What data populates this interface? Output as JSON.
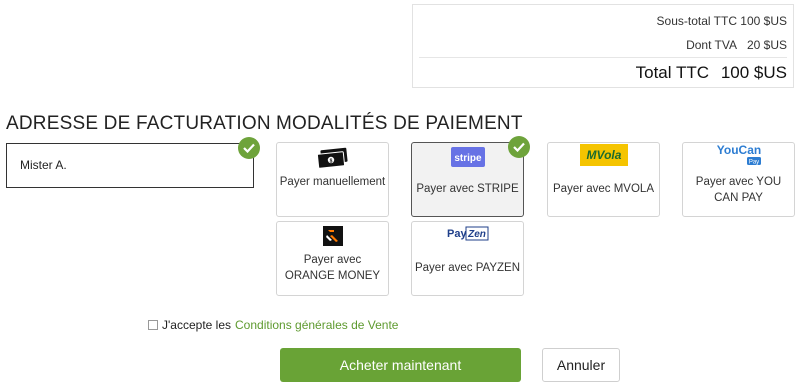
{
  "totals": {
    "subtotal_label": "Sous-total TTC",
    "subtotal_value": "100 $US",
    "tax_label": "Dont TVA",
    "tax_value": "20 $US",
    "total_label": "Total TTC",
    "total_value": "100 $US"
  },
  "billing": {
    "heading": "ADRESSE DE FACTURATION",
    "address": "Mister A."
  },
  "payment": {
    "heading": "MODALITÉS DE PAIEMENT",
    "methods": [
      {
        "label": "Payer manuellement",
        "icon": "cash-icon"
      },
      {
        "label": "Payer avec STRIPE",
        "icon": "stripe-logo",
        "logo_text": "stripe",
        "selected": true
      },
      {
        "label": "Payer avec MVOLA",
        "icon": "mvola-logo",
        "logo_text": "MVola"
      },
      {
        "label": "Payer avec YOU CAN PAY",
        "icon": "youcanpay-logo",
        "logo_text": "YouCan",
        "logo_sub": "Pay"
      },
      {
        "label": "Payer avec ORANGE MONEY",
        "icon": "orange-money-logo"
      },
      {
        "label": "Payer avec PAYZEN",
        "icon": "payzen-logo",
        "logo_text": "Pay",
        "logo_text2": "Zen"
      }
    ]
  },
  "terms": {
    "prefix": "J'accepte les",
    "link": "Conditions générales de Vente"
  },
  "actions": {
    "buy": "Acheter maintenant",
    "cancel": "Annuler"
  },
  "colors": {
    "accent": "#69a336",
    "link": "#5e9a2f",
    "stripe": "#6772e5",
    "mvola_bg": "#f5c400",
    "youcan": "#2d7dd2"
  }
}
